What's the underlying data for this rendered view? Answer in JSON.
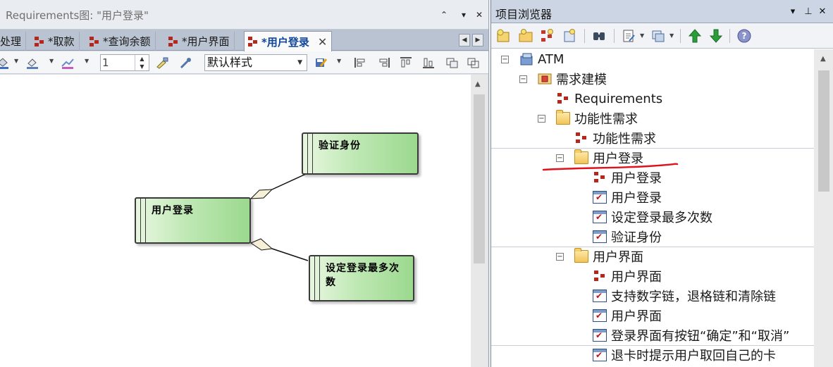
{
  "diagram_window": {
    "title": "Requirements图: \"用户登录\"",
    "title_buttons": {
      "float": "⌃",
      "menu": "▾",
      "close": "✕"
    },
    "tabs": [
      {
        "label": "处理",
        "active": false
      },
      {
        "label": "*取款",
        "active": false
      },
      {
        "label": "*查询余额",
        "active": false
      },
      {
        "label": "*用户界面",
        "active": false
      },
      {
        "label": "*用户登录",
        "active": true
      }
    ],
    "tab_close": "✕",
    "tab_scroll": {
      "left": "◀",
      "right": "▶"
    }
  },
  "diagram_toolbar": {
    "line_width_value": "1",
    "style_select": "默认样式"
  },
  "diagram": {
    "elements": [
      {
        "label": "验证身份"
      },
      {
        "label": "用户登录"
      },
      {
        "label": "设定登录最多次数"
      }
    ]
  },
  "project_browser": {
    "title": "项目浏览器",
    "title_buttons": {
      "menu": "▾",
      "pin": "⊥",
      "close": "✕"
    },
    "tree": [
      {
        "label": "ATM",
        "icon": "package-model-icon",
        "toggle": "⊟"
      },
      {
        "label": "需求建模",
        "icon": "model-view-icon",
        "toggle": "⊟"
      },
      {
        "label": "Requirements",
        "icon": "requirements-diagram-icon"
      },
      {
        "label": "功能性需求",
        "icon": "folder-icon",
        "toggle": "⊟"
      },
      {
        "label": "功能性需求",
        "icon": "requirements-diagram-icon"
      },
      {
        "label": "用户登录",
        "icon": "folder-icon",
        "toggle": "⊟"
      },
      {
        "label": "用户登录",
        "icon": "requirements-diagram-icon"
      },
      {
        "label": "用户登录",
        "icon": "requirement-icon"
      },
      {
        "label": "设定登录最多次数",
        "icon": "requirement-icon"
      },
      {
        "label": "验证身份",
        "icon": "requirement-icon"
      },
      {
        "label": "用户界面",
        "icon": "folder-icon",
        "toggle": "⊟"
      },
      {
        "label": "用户界面",
        "icon": "requirements-diagram-icon"
      },
      {
        "label": "支持数字链，退格链和清除链",
        "icon": "requirement-icon"
      },
      {
        "label": "用户界面",
        "icon": "requirement-icon"
      },
      {
        "label": "登录界面有按钮“确定”和“取消”",
        "icon": "requirement-icon"
      },
      {
        "label": "退卡时提示用户取回自己的卡",
        "icon": "requirement-icon"
      }
    ],
    "annotation_color": "#e0121c"
  }
}
